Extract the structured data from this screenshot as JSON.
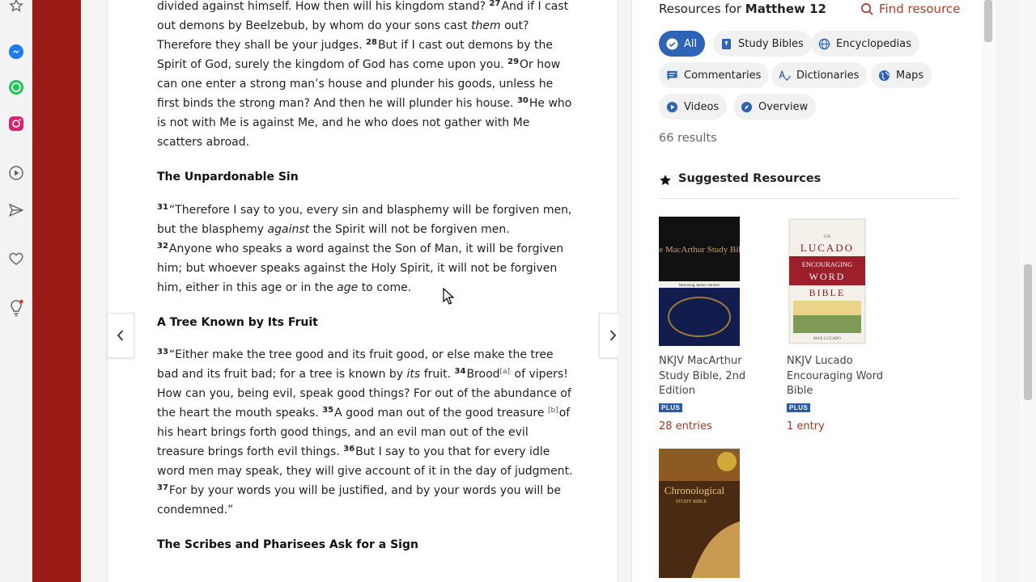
{
  "passage": {
    "verse26_tail": "divided against himself. How then will his kingdom stand?",
    "v27": "27",
    "verse27_a": "And if I cast out demons by Beelzebub, by whom do your sons cast",
    "verse27_em": "them",
    "verse27_b": "out? Therefore they shall be your judges.",
    "v28": "28",
    "verse28": "But if I cast out demons by the Spirit of God, surely the kingdom of God has come upon you.",
    "v29": "29",
    "verse29": "Or how can one enter a strong man’s house and plunder his goods, unless he first binds the strong man? And then he will plunder his house.",
    "v30": "30",
    "verse30": "He who is not with Me is against Me, and he who does not gather with Me scatters abroad.",
    "heading1": "The Unpardonable Sin",
    "v31": "31",
    "verse31_a": "“Therefore I say to you, every sin and blasphemy will be forgiven men, but the blasphemy",
    "verse31_em": "against",
    "verse31_b": "the Spirit will not be forgiven men.",
    "v32": "32",
    "verse32_a": "Anyone who speaks a word against the Son of Man, it will be forgiven him; but whoever speaks against the Holy Spirit, it will not be forgiven him, either in this age or in the",
    "verse32_em": "age",
    "verse32_b": "to come.",
    "heading2": "A Tree Known by Its Fruit",
    "v33": "33",
    "verse33_a": "“Either make the tree good and its fruit good, or else make the tree bad and its fruit bad; for a tree is known by",
    "verse33_em": "its",
    "verse33_b": "fruit.",
    "v34": "34",
    "verse34_a": "Brood",
    "fn_a": "[a]",
    "verse34_b": "of vipers! How can you, being evil, speak good things? For out of the abundance of the heart the mouth speaks.",
    "v35": "35",
    "verse35_a": "A good man out of the good treasure",
    "fn_b": "[b]",
    "verse35_b": "of his heart brings forth good things, and an evil man out of the evil treasure brings forth evil things.",
    "v36": "36",
    "verse36": "But I say to you that for every idle word men may speak, they will give account of it in the day of judgment.",
    "v37": "37",
    "verse37": "For by your words you will be justified, and by your words you will be condemned.”",
    "heading3": "The Scribes and Pharisees Ask for a Sign"
  },
  "resources": {
    "heading_prefix": "Resources for",
    "heading_ref": "Matthew 12",
    "find_label": "Find resource",
    "chips": [
      {
        "label": "All",
        "icon": "check-circle-icon",
        "active": true
      },
      {
        "label": "Study Bibles",
        "icon": "study-bible-icon"
      },
      {
        "label": "Encyclopedias",
        "icon": "globe-icon"
      },
      {
        "label": "Commentaries",
        "icon": "comment-icon"
      },
      {
        "label": "Dictionaries",
        "icon": "spell-check-icon"
      },
      {
        "label": "Maps",
        "icon": "map-globe-icon"
      },
      {
        "label": "Videos",
        "icon": "play-circle-icon"
      },
      {
        "label": "Overview",
        "icon": "compass-icon"
      }
    ],
    "results_count": "66 results",
    "suggested_heading": "Suggested Resources",
    "books": [
      {
        "title": "NKJV MacArthur Study Bible, 2nd Edition",
        "badge": "PLUS",
        "entries": "28 entries",
        "cover_title": "The MacArthur Study Bible",
        "cover_sub": "New King James Version"
      },
      {
        "title": "NKJV Lucado Encouraging Word Bible",
        "badge": "PLUS",
        "entries": "1 entry",
        "cover_title_1": "THE",
        "cover_title_2": "LUCADO",
        "cover_title_3": "ENCOURAGING",
        "cover_title_4": "WORD",
        "cover_title_5": "BIBLE",
        "cover_author": "MAX LUCADO"
      },
      {
        "title": "Chronological Study Bible",
        "cover_title": "Chronological",
        "cover_sub": "STUDY BIBLE"
      }
    ]
  },
  "colors": {
    "accent": "#2e64b6",
    "brand_red": "#9b1c17",
    "link_red": "#b23a2a"
  }
}
